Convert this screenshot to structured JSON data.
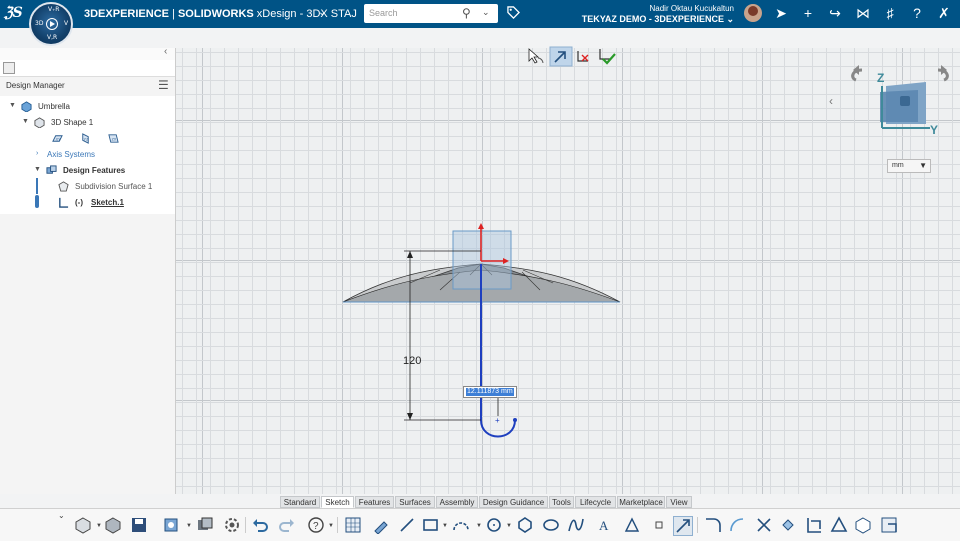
{
  "app": {
    "brand": "3DEXPERIENCE",
    "separator": " | ",
    "product": "SOLIDWORKS",
    "app_name": " xDesign - 3DX STAJ"
  },
  "compass": {
    "top": "V₊R",
    "left": "3D",
    "right": "V",
    "bottom": "V,R"
  },
  "search": {
    "placeholder": "Search"
  },
  "user": {
    "name": "Nadir Oktau Kucukaltun",
    "tenant": "TEKYAZ DEMO - 3DEXPERIENCE"
  },
  "panel": {
    "title": "Design Manager",
    "tree": [
      {
        "label": "Umbrella",
        "icon": "part-icon"
      },
      {
        "label": "3D Shape 1",
        "icon": "shape-icon"
      },
      {
        "label": "Axis Systems",
        "icon": "axis-icon"
      },
      {
        "label": "Design Features",
        "icon": "features-icon"
      },
      {
        "label": "Subdivision Surface 1",
        "icon": "subd-icon"
      },
      {
        "label": "(-)",
        "icon": "sketch-icon"
      },
      {
        "label": "Sketch.1",
        "icon": "sketch-icon"
      }
    ],
    "planes": [
      "XY",
      "YZ",
      "ZX"
    ]
  },
  "view": {
    "unit": "mm",
    "axis_z": "Z",
    "axis_y": "Y"
  },
  "sketch": {
    "dimension_vertical": "120",
    "dimension_input": "12.111873 mm"
  },
  "colors": {
    "brand": "#005386",
    "accent": "#1e3fbf",
    "dimension_highlight": "#3d7fd6"
  },
  "tabs": [
    "Standard",
    "Sketch",
    "Features",
    "Surfaces",
    "Assembly",
    "Design Guidance",
    "Tools",
    "Lifecycle",
    "Marketplace",
    "View"
  ],
  "active_tab": "Sketch",
  "toolbar_icons": [
    "expand-icon",
    "new-part-icon",
    "open-icon",
    "save-icon",
    "import-icon",
    "share-icon",
    "settings-icon",
    "undo-icon",
    "redo-icon",
    "help-icon",
    "sketch-grid-icon",
    "line-pen-icon",
    "line-icon",
    "rectangle-icon",
    "arc-icon",
    "circle-icon",
    "polygon-icon",
    "ellipse-icon",
    "spline-icon",
    "text-icon",
    "point-icon",
    "construction-icon",
    "fillet-icon",
    "chamfer-icon",
    "trim-icon",
    "mirror-icon",
    "offset-icon",
    "convert-icon",
    "project-icon",
    "intersect-icon"
  ]
}
